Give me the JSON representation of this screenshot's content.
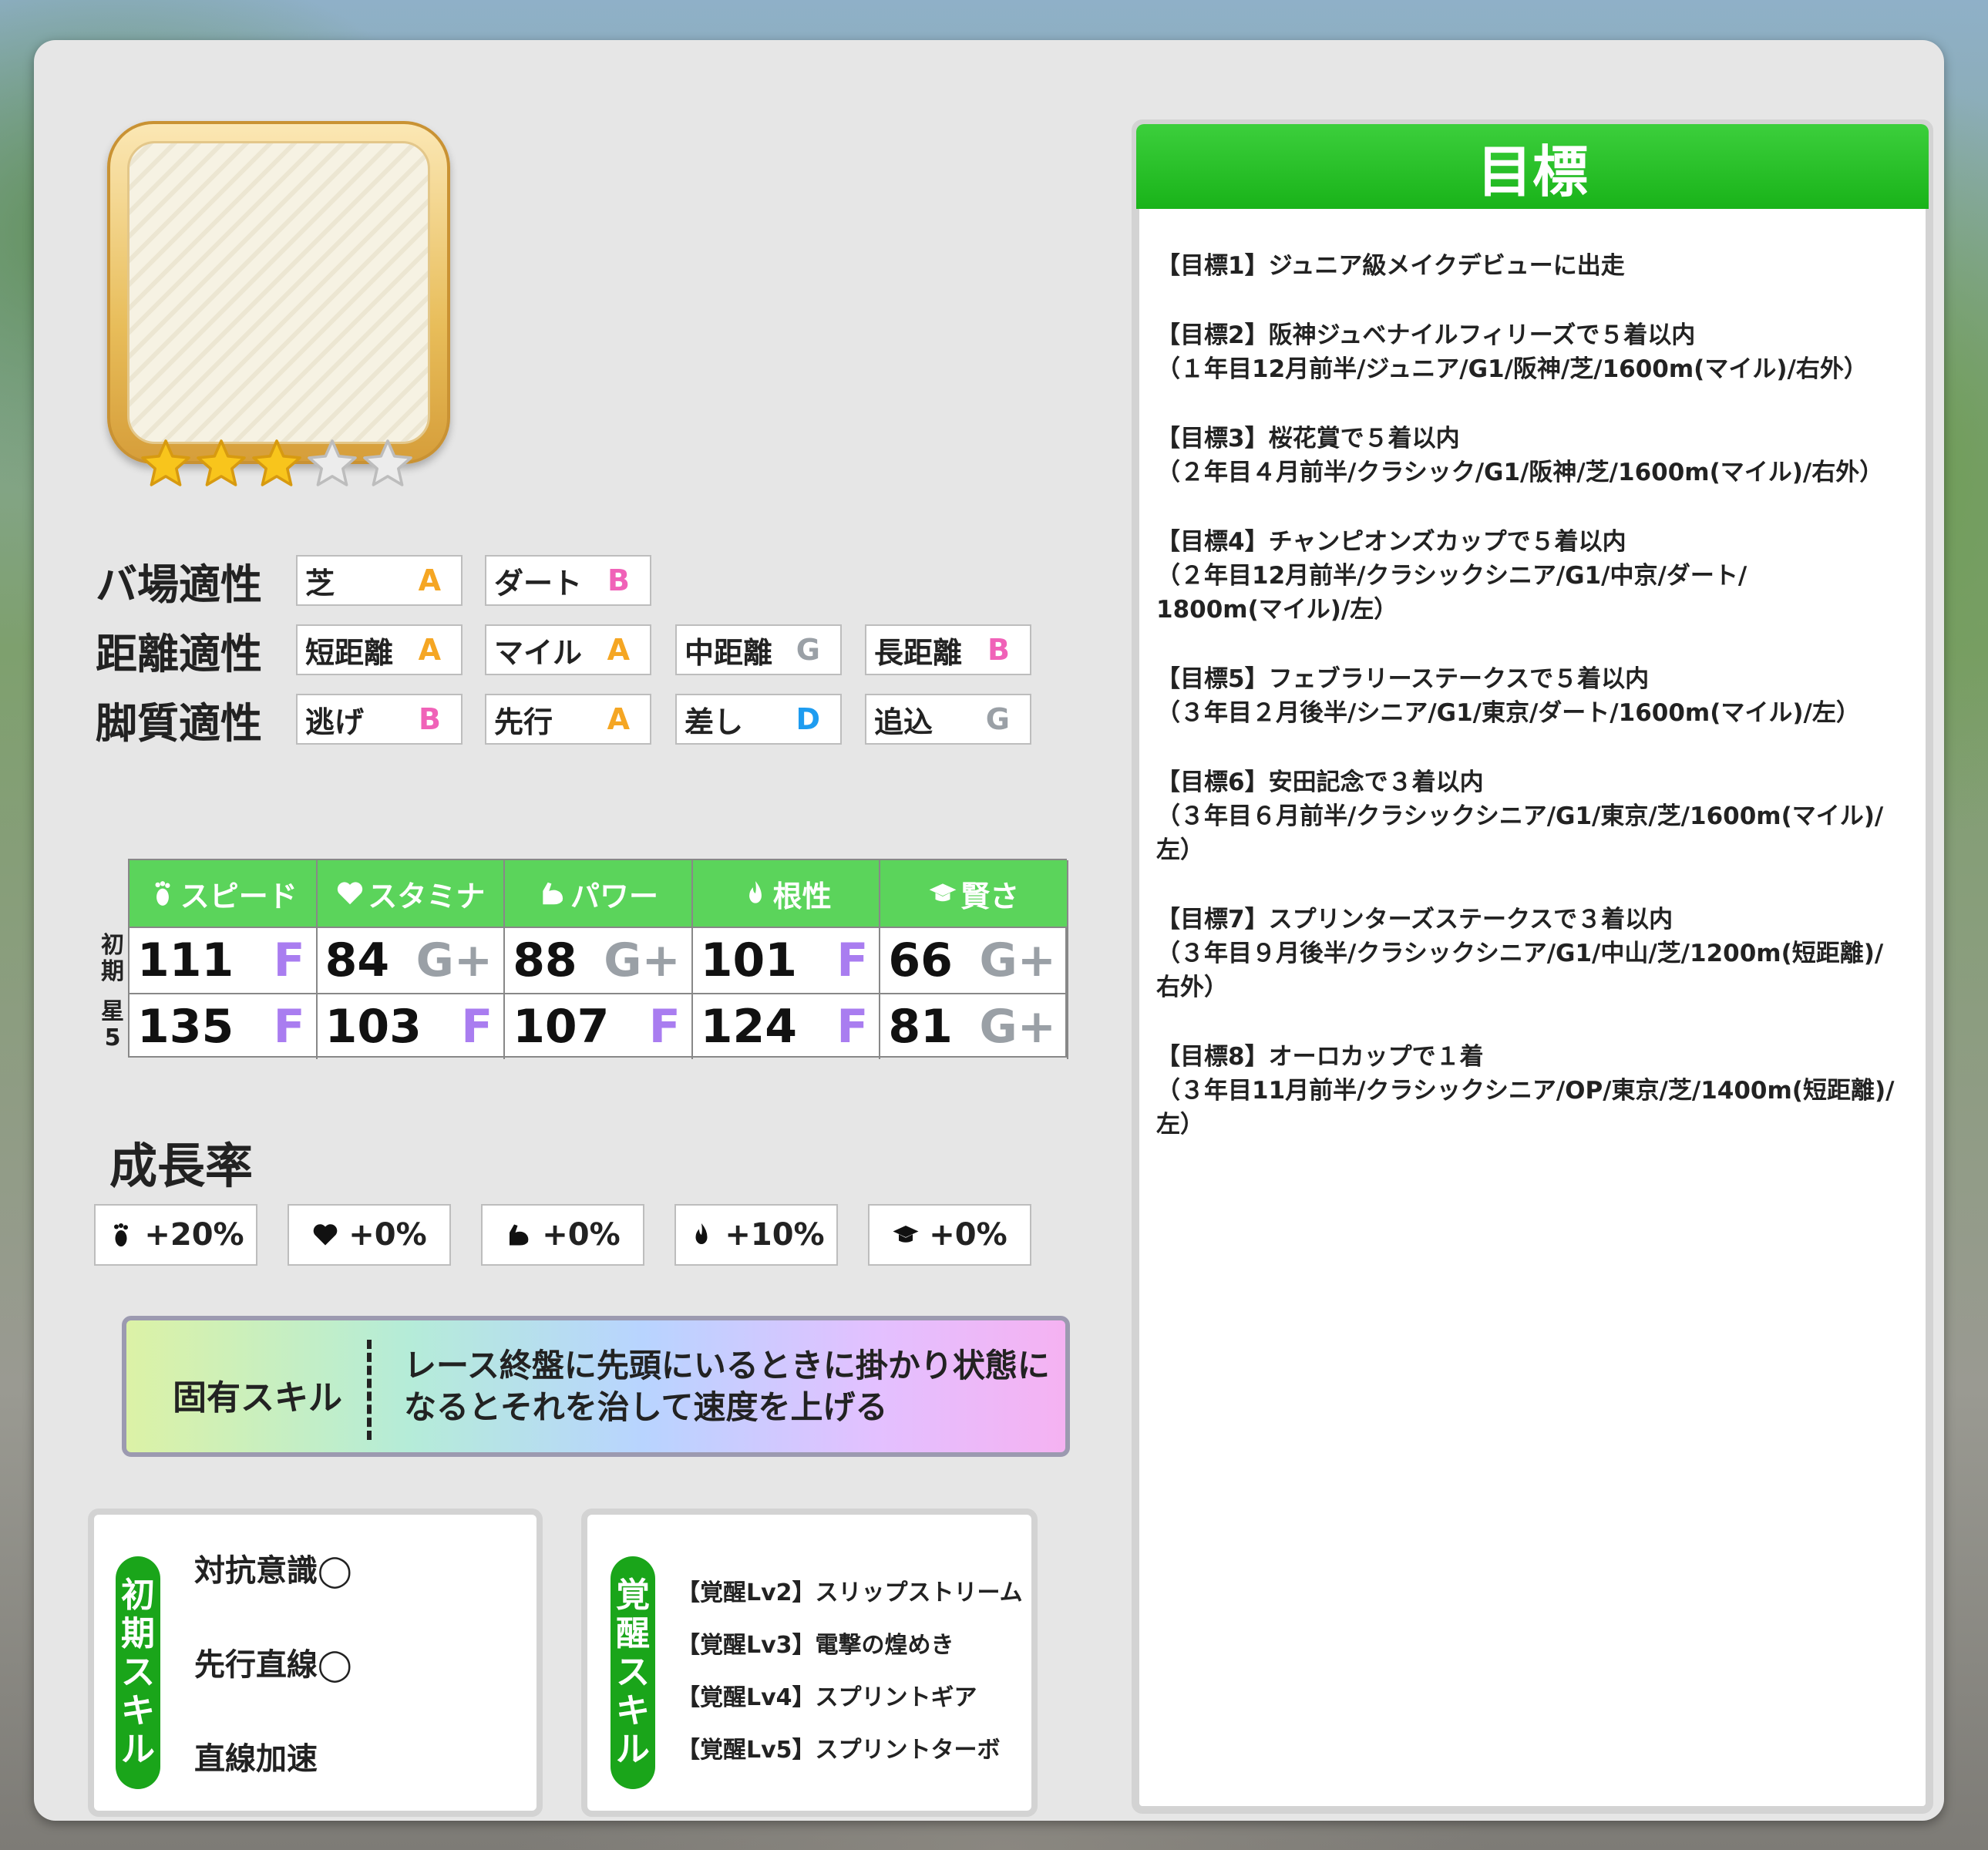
{
  "stars": {
    "filled": 3,
    "total": 5
  },
  "aptitude": {
    "rows": [
      {
        "title": "バ場適性",
        "items": [
          {
            "label": "芝",
            "grade": "A"
          },
          {
            "label": "ダート",
            "grade": "B"
          }
        ]
      },
      {
        "title": "距離適性",
        "items": [
          {
            "label": "短距離",
            "grade": "A"
          },
          {
            "label": "マイル",
            "grade": "A"
          },
          {
            "label": "中距離",
            "grade": "G"
          },
          {
            "label": "長距離",
            "grade": "B"
          }
        ]
      },
      {
        "title": "脚質適性",
        "items": [
          {
            "label": "逃げ",
            "grade": "B"
          },
          {
            "label": "先行",
            "grade": "A"
          },
          {
            "label": "差し",
            "grade": "D"
          },
          {
            "label": "追込",
            "grade": "G"
          }
        ]
      }
    ],
    "grade_colors": {
      "A": "#f5a623",
      "B": "#f062b8",
      "D": "#1e9cf0",
      "G": "#9aa0a6"
    }
  },
  "stats": {
    "headers": [
      {
        "label": "スピード",
        "icon": "footprint-icon"
      },
      {
        "label": "スタミナ",
        "icon": "heart-icon"
      },
      {
        "label": "パワー",
        "icon": "arm-icon"
      },
      {
        "label": "根性",
        "icon": "flame-icon"
      },
      {
        "label": "賢さ",
        "icon": "mortarboard-icon"
      }
    ],
    "row_labels": [
      "初期",
      "星5"
    ],
    "initial": [
      {
        "value": "111",
        "grade": "F"
      },
      {
        "value": "84",
        "grade": "G+"
      },
      {
        "value": "88",
        "grade": "G+"
      },
      {
        "value": "101",
        "grade": "F"
      },
      {
        "value": "66",
        "grade": "G+"
      }
    ],
    "star5": [
      {
        "value": "135",
        "grade": "F"
      },
      {
        "value": "103",
        "grade": "F"
      },
      {
        "value": "107",
        "grade": "F"
      },
      {
        "value": "124",
        "grade": "F"
      },
      {
        "value": "81",
        "grade": "G+"
      }
    ],
    "grade_colors": {
      "F": "#a97df0",
      "G+": "#9aa0a6"
    },
    "header_color": "#5bd45b"
  },
  "growth": {
    "title": "成長率",
    "items": [
      {
        "icon": "footprint-icon",
        "value": "+20%"
      },
      {
        "icon": "heart-icon",
        "value": "+0%"
      },
      {
        "icon": "arm-icon",
        "value": "+0%"
      },
      {
        "icon": "flame-icon",
        "value": "+10%"
      },
      {
        "icon": "mortarboard-icon",
        "value": "+0%"
      }
    ]
  },
  "unique_skill": {
    "label": "固有スキル",
    "line1": "レース終盤に先頭にいるときに掛かり状態に",
    "line2": "なるとそれを治して速度を上げる"
  },
  "initial_skills": {
    "label": "初期スキル",
    "items": [
      "対抗意識◯",
      "先行直線◯",
      "直線加速"
    ]
  },
  "awakening_skills": {
    "label": "覚醒スキル",
    "items": [
      "【覚醒Lv2】スリップストリーム",
      "【覚醒Lv3】電撃の煌めき",
      "【覚醒Lv4】スプリントギア",
      "【覚醒Lv5】スプリントターボ"
    ]
  },
  "goals": {
    "title": "目標",
    "items": [
      {
        "head": "【目標1】ジュニア級メイクデビューに出走",
        "lines": []
      },
      {
        "head": "【目標2】阪神ジュベナイルフィリーズで５着以内",
        "lines": [
          "（１年目12月前半/ジュニア/G1/阪神/芝/1600m(マイル)/右外）"
        ]
      },
      {
        "head": "【目標3】桜花賞で５着以内",
        "lines": [
          "（２年目４月前半/クラシック/G1/阪神/芝/1600m(マイル)/右外）"
        ]
      },
      {
        "head": "【目標4】チャンピオンズカップで５着以内",
        "lines": [
          "（２年目12月前半/クラシックシニア/G1/中京/ダート/",
          "1800m(マイル)/左）"
        ]
      },
      {
        "head": "【目標5】フェブラリーステークスで５着以内",
        "lines": [
          "（３年目２月後半/シニア/G1/東京/ダート/1600m(マイル)/左）"
        ]
      },
      {
        "head": "【目標6】安田記念で３着以内",
        "lines": [
          "（３年目６月前半/クラシックシニア/G1/東京/芝/1600m(マイル)/",
          "左）"
        ]
      },
      {
        "head": "【目標7】スプリンターズステークスで３着以内",
        "lines": [
          "（３年目９月後半/クラシックシニア/G1/中山/芝/1200m(短距離)/",
          "右外）"
        ]
      },
      {
        "head": "【目標8】オーロカップで１着",
        "lines": [
          "（３年目11月前半/クラシックシニア/OP/東京/芝/1400m(短距離)/",
          "左）"
        ]
      }
    ]
  }
}
